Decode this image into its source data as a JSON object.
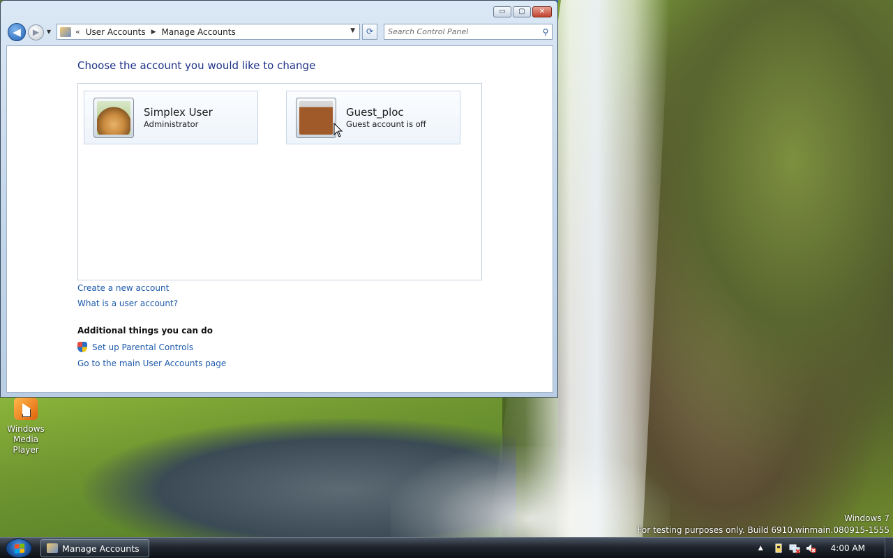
{
  "desktop": {
    "icons": [
      {
        "label_line1": "Windows",
        "label_line2": "Media Player"
      }
    ],
    "watermark": {
      "line1": "Windows 7",
      "line2": "For testing purposes only. Build 6910.winmain.080915-1555"
    }
  },
  "window": {
    "controls": {
      "minimize": "▭",
      "maximize": "▢",
      "close": "✕"
    },
    "nav": {
      "back_glyph": "◀",
      "forward_glyph": "▶",
      "history_glyph": "▼",
      "breadcrumb_prefix": "«",
      "breadcrumbs": [
        "User Accounts",
        "Manage Accounts"
      ],
      "separator": "▶",
      "dropdown_glyph": "▼",
      "refresh_glyph": "⟳",
      "search_placeholder": "Search Control Panel",
      "search_glyph": "⚲"
    },
    "content": {
      "title": "Choose the account you would like to change",
      "accounts": [
        {
          "name": "Simplex User",
          "type": "Administrator",
          "picture": "dog-picture"
        },
        {
          "name": "Guest_ploc",
          "type": "Guest account is off",
          "picture": "suitcase-picture"
        }
      ],
      "links": {
        "create": "Create a new account",
        "what": "What is a user account?"
      },
      "additional_heading": "Additional things you can do",
      "additional_links": {
        "parental": "Set up Parental Controls",
        "main_page": "Go to the main User Accounts page"
      }
    }
  },
  "taskbar": {
    "open_window_label": "Manage Accounts",
    "tray_arrow": "▲",
    "clock": "4:00 AM"
  },
  "colors": {
    "link": "#1d5aab",
    "title": "#1e3287"
  }
}
